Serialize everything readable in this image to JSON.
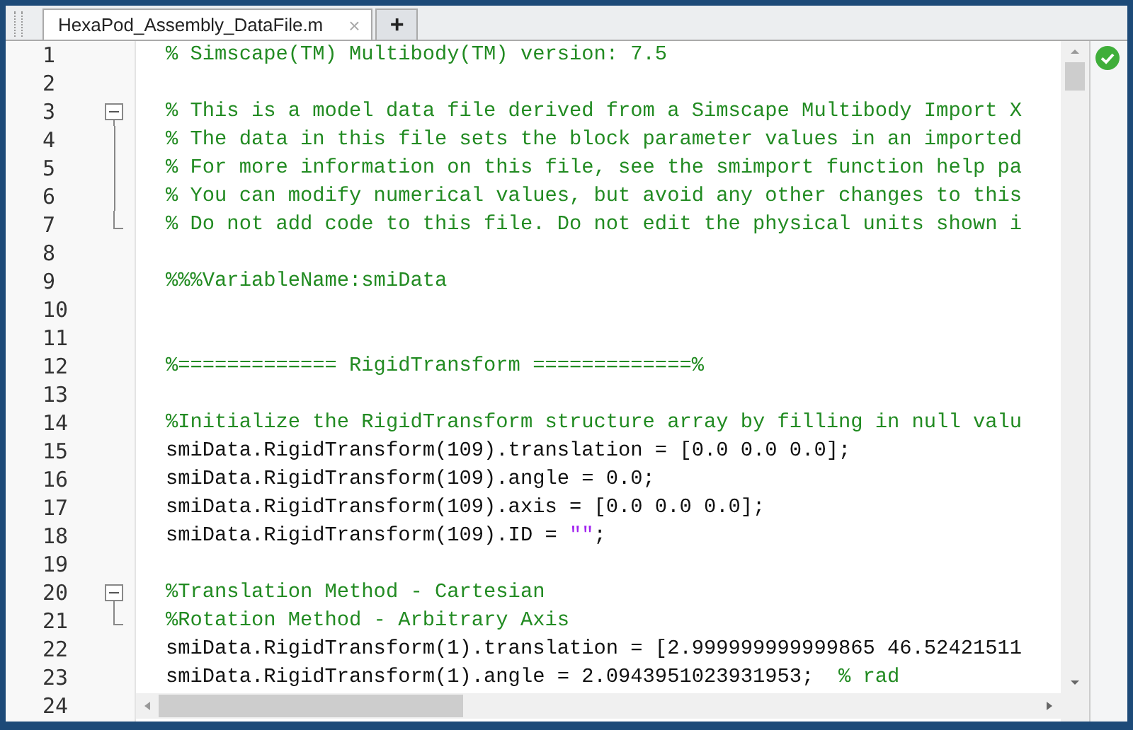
{
  "tabs": [
    {
      "label": "HexaPod_Assembly_DataFile.m",
      "close": "×",
      "selected": true
    },
    {
      "label": "+",
      "selected": false
    }
  ],
  "editor": {
    "lines": [
      {
        "number": "1",
        "kind": "plain",
        "segments": [
          {
            "kind": "comment",
            "text": "% Simscape(TM) Multibody(TM) version: 7.5"
          }
        ]
      },
      {
        "number": "2",
        "kind": "plain"
      },
      {
        "number": "3",
        "kind": "fold_start",
        "segments": [
          {
            "kind": "comment",
            "text": "% This is a model data file derived from a Simscape Multibody Import X"
          }
        ]
      },
      {
        "number": "4",
        "kind": "fold_mid",
        "segments": [
          {
            "kind": "comment",
            "text": "% The data in this file sets the block parameter values in an imported"
          }
        ]
      },
      {
        "number": "5",
        "kind": "fold_mid",
        "segments": [
          {
            "kind": "comment",
            "text": "% For more information on this file, see the smimport function help pa"
          }
        ]
      },
      {
        "number": "6",
        "kind": "fold_mid",
        "segments": [
          {
            "kind": "comment",
            "text": "% You can modify numerical values, but avoid any other changes to this"
          }
        ]
      },
      {
        "number": "7",
        "kind": "fold_end",
        "segments": [
          {
            "kind": "comment",
            "text": "% Do not add code to this file. Do not edit the physical units shown i"
          }
        ]
      },
      {
        "number": "8",
        "kind": "plain"
      },
      {
        "number": "9",
        "kind": "plain",
        "segments": [
          {
            "kind": "comment",
            "text": "%%%VariableName:smiData"
          }
        ]
      },
      {
        "number": "10",
        "kind": "plain"
      },
      {
        "number": "11",
        "kind": "plain"
      },
      {
        "number": "12",
        "kind": "plain",
        "segments": [
          {
            "kind": "comment",
            "text": "%============= RigidTransform =============%"
          }
        ]
      },
      {
        "number": "13",
        "kind": "plain"
      },
      {
        "number": "14",
        "kind": "plain",
        "segments": [
          {
            "kind": "comment",
            "text": "%Initialize the RigidTransform structure array by filling in null valu"
          }
        ]
      },
      {
        "number": "15",
        "kind": "plain",
        "segments": [
          {
            "kind": "code",
            "text": "smiData.RigidTransform(109).translation = [0.0 0.0 0.0];"
          }
        ]
      },
      {
        "number": "16",
        "kind": "plain",
        "segments": [
          {
            "kind": "code",
            "text": "smiData.RigidTransform(109).angle = 0.0;"
          }
        ]
      },
      {
        "number": "17",
        "kind": "plain",
        "segments": [
          {
            "kind": "code",
            "text": "smiData.RigidTransform(109).axis = [0.0 0.0 0.0];"
          }
        ]
      },
      {
        "number": "18",
        "kind": "plain",
        "segments": [
          {
            "kind": "code",
            "text": "smiData.RigidTransform(109).ID = "
          },
          {
            "kind": "string",
            "text": "\"\""
          },
          {
            "kind": "code",
            "text": ";"
          }
        ]
      },
      {
        "number": "19",
        "kind": "plain"
      },
      {
        "number": "20",
        "kind": "fold_start",
        "segments": [
          {
            "kind": "comment",
            "text": "%Translation Method - Cartesian"
          }
        ]
      },
      {
        "number": "21",
        "kind": "fold_end",
        "segments": [
          {
            "kind": "comment",
            "text": "%Rotation Method - Arbitrary Axis"
          }
        ]
      },
      {
        "number": "22",
        "kind": "plain",
        "segments": [
          {
            "kind": "code",
            "text": "smiData.RigidTransform(1).translation = [2.999999999999865 46.52421511"
          }
        ]
      },
      {
        "number": "23",
        "kind": "plain",
        "segments": [
          {
            "kind": "code",
            "text": "smiData.RigidTransform(1).angle = 2.0943951023931953;  "
          },
          {
            "kind": "comment",
            "text": "% rad"
          }
        ]
      },
      {
        "number": "24",
        "kind": "plain"
      }
    ]
  }
}
